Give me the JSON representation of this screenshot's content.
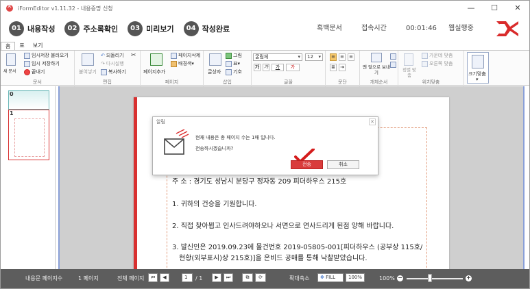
{
  "window": {
    "title": "iFormEditor v1.11.32 - 내용증명 신청",
    "minimize_icon": "minimize-icon",
    "maximize_icon": "maximize-icon",
    "close_icon": "close-icon"
  },
  "steps": [
    {
      "num": "01",
      "label": "내용작성"
    },
    {
      "num": "02",
      "label": "주소록확인"
    },
    {
      "num": "03",
      "label": "미리보기"
    },
    {
      "num": "04",
      "label": "작성완료"
    }
  ],
  "header": {
    "doc_type": "혹백문서",
    "session_label": "접속시간",
    "session_time": "00:01:46",
    "sender": "웹실행중"
  },
  "ribbon": {
    "tabs": [
      "홈",
      "표",
      "보기"
    ],
    "groups": {
      "doc": {
        "label": "문서",
        "new": "새 문서",
        "open_temp": "임시저장 불러오기",
        "save_temp": "임시 저장하기",
        "quit": "끝내기"
      },
      "edit": {
        "label": "편집",
        "paste": "붙여넣기",
        "undo": "되돌리기",
        "redo": "다시실행",
        "copy": "복사하기"
      },
      "page": {
        "label": "페이지",
        "add": "페이지추가",
        "delete": "페이지삭제",
        "background": "배경색"
      },
      "insert": {
        "label": "삽입",
        "textbox": "글상자",
        "image": "그림",
        "table": "표",
        "symbol": "기호"
      },
      "font": {
        "label": "글꼴",
        "face": "굴림체",
        "size": "12",
        "bold": "가",
        "italic": "가",
        "underline": "가",
        "color": "가"
      },
      "para": {
        "label": "문단"
      },
      "objorder": {
        "label": "개체순서",
        "front": "맨 앞으로 보내기"
      },
      "align": {
        "label": "위치맞춤",
        "align": "정렬 맞춤",
        "center": "가운데 맞춤",
        "right": "오른쪽 맞춤"
      },
      "zoom": {
        "fit": "크기맞춤"
      }
    }
  },
  "thumbnails": [
    {
      "num": "0"
    },
    {
      "num": "1"
    }
  ],
  "document": {
    "lines": [
      "주    소 : 경기도 성남시 분당구 정자동 209 피더하우스 215호",
      "1. 귀하의 건승을 기원합니다.",
      "2. 직접 찾아뵙고 인사드려야하오나 서면으로 연사드리게 된점 양해 바랍니다.",
      "3. 발신인은 2019.09.23에 물건번호 2019-05805-001[피더하우스 (공부상 115호/",
      "현황(외부표시)상 215호)]을 온비드 공매를 통해 낙찰받았습니다."
    ]
  },
  "dialog": {
    "title": "알림",
    "message1": "현재 내용은 총 페이지 수는 1매 입니다.",
    "message2": "전송하시겠습니까?",
    "ok": "전송",
    "cancel": "취소",
    "icon": "mail-icon"
  },
  "statusbar": {
    "pages_label": "내용문 페이지수",
    "pages_value": "1 페이지",
    "total_label": "전체 페이지",
    "current_page": "1",
    "total_pages": "/ 1",
    "zoom_label": "확대축소",
    "fill": "FILL",
    "zoom_pct_btn": "100%",
    "zoom_value": "100%",
    "zoom_level": 0.42
  }
}
